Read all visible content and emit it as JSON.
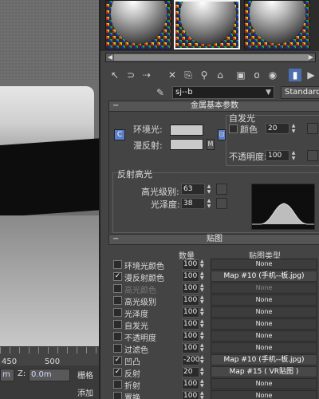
{
  "viewport": {
    "ruler_labels": [
      "450",
      "500"
    ],
    "x_value": "m",
    "z_label": "Z:",
    "z_value": "0.0m",
    "grid_label": "栅格",
    "add_label": "添加"
  },
  "toolbar": {
    "icons": [
      "get-material-icon",
      "put-to-scene-icon",
      "assign-icon",
      "reset-icon",
      "copy-icon",
      "unique-icon",
      "put-library-icon",
      "material-id-icon",
      "show-map-icon",
      "show-end-icon",
      "go-parent-icon",
      "go-sibling-icon"
    ]
  },
  "material": {
    "name": "sj--b",
    "type": "Standard"
  },
  "metal_params": {
    "title": "金属基本参数",
    "ambient_label": "环境光:",
    "diffuse_label": "漫反射:",
    "m_label": "M",
    "self_illum_title": "自发光",
    "color_label": "颜色",
    "color_value": "20",
    "opacity_label": "不透明度:",
    "opacity_value": "100",
    "spec_title": "反射高光",
    "spec_level_label": "高光级别:",
    "spec_level_value": "63",
    "gloss_label": "光泽度:",
    "gloss_value": "38"
  },
  "maps": {
    "title": "贴图",
    "col_amount": "数量",
    "col_type": "贴图类型",
    "rows": [
      {
        "name": "环境光颜色",
        "amount": "100",
        "map": "None",
        "checked": false,
        "dim": false
      },
      {
        "name": "漫反射颜色",
        "amount": "100",
        "map": "Map #10 (手机--板.jpg)",
        "checked": true,
        "dim": false
      },
      {
        "name": "高光颜色",
        "amount": "100",
        "map": "None",
        "checked": false,
        "dim": true
      },
      {
        "name": "高光级别",
        "amount": "100",
        "map": "None",
        "checked": false,
        "dim": false
      },
      {
        "name": "光泽度",
        "amount": "100",
        "map": "None",
        "checked": false,
        "dim": false
      },
      {
        "name": "自发光",
        "amount": "100",
        "map": "None",
        "checked": false,
        "dim": false
      },
      {
        "name": "不透明度",
        "amount": "100",
        "map": "None",
        "checked": false,
        "dim": false
      },
      {
        "name": "过滤色",
        "amount": "100",
        "map": "None",
        "checked": false,
        "dim": false
      },
      {
        "name": "凹凸",
        "amount": "-200",
        "map": "Map #10 (手机--板.jpg)",
        "checked": true,
        "dim": false
      },
      {
        "name": "反射",
        "amount": "20",
        "map": "Map #15 ( VR贴图 )",
        "checked": true,
        "dim": false
      },
      {
        "name": "折射",
        "amount": "100",
        "map": "None",
        "checked": false,
        "dim": false
      },
      {
        "name": "置换",
        "amount": "100",
        "map": "None",
        "checked": false,
        "dim": false
      }
    ]
  }
}
